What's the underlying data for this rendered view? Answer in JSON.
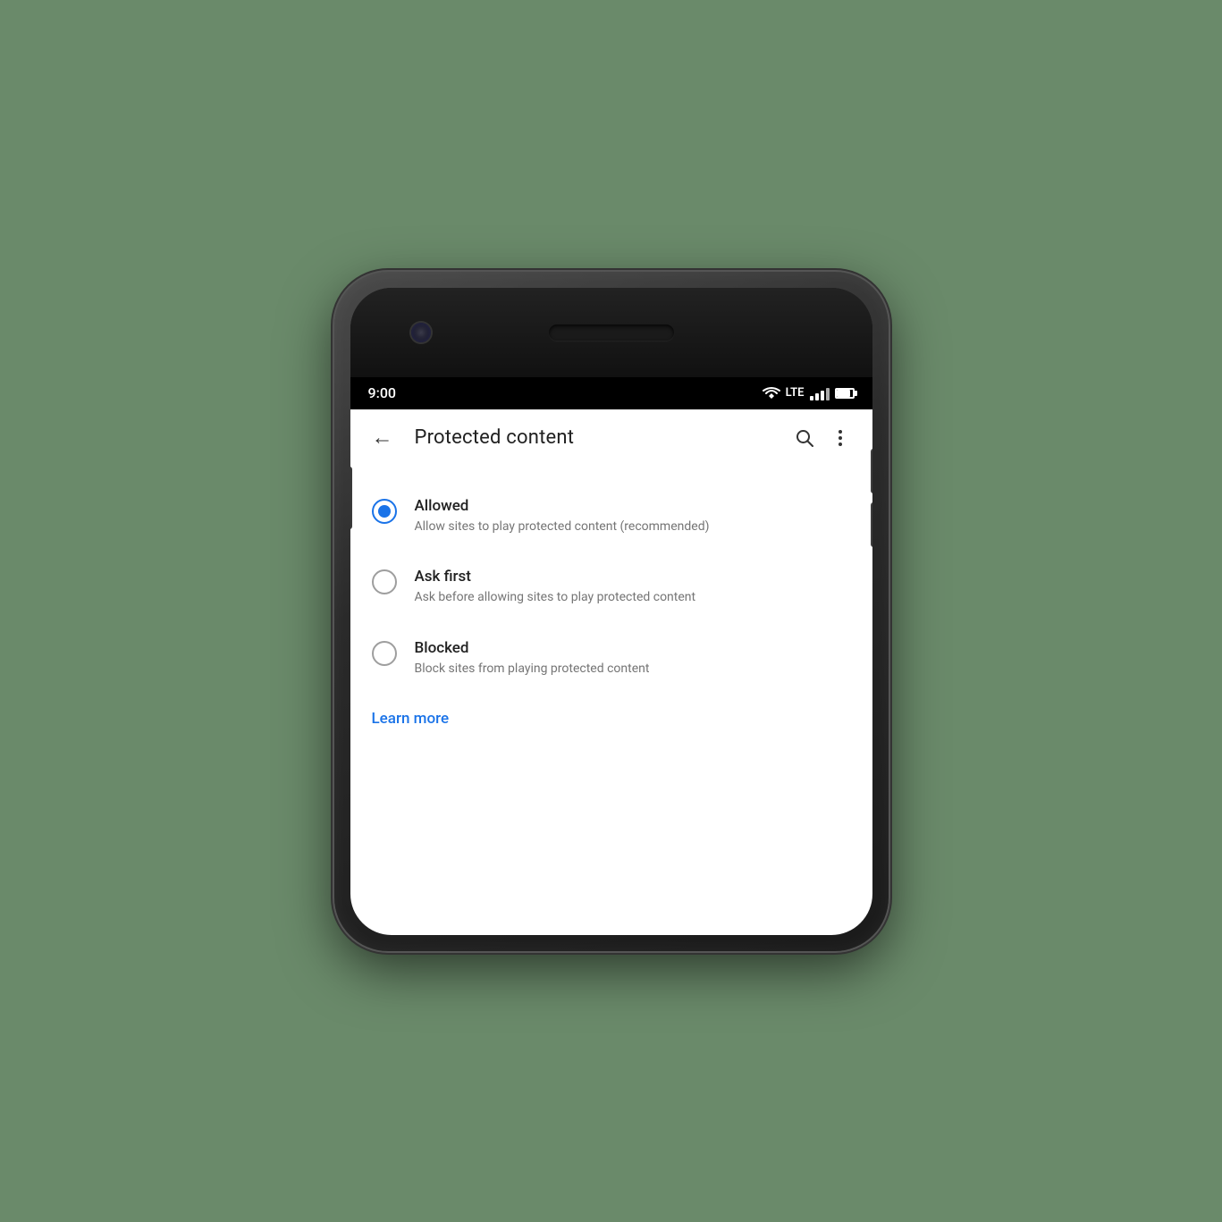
{
  "status_bar": {
    "time": "9:00",
    "lte": "LTE"
  },
  "app_bar": {
    "title": "Protected content",
    "back_label": "←",
    "search_label": "search",
    "more_label": "more"
  },
  "options": [
    {
      "id": "allowed",
      "title": "Allowed",
      "description": "Allow sites to play protected content (recommended)",
      "selected": true
    },
    {
      "id": "ask-first",
      "title": "Ask first",
      "description": "Ask before allowing sites to play protected content",
      "selected": false
    },
    {
      "id": "blocked",
      "title": "Blocked",
      "description": "Block sites from playing protected content",
      "selected": false
    }
  ],
  "learn_more": "Learn more",
  "accent_color": "#1a73e8"
}
